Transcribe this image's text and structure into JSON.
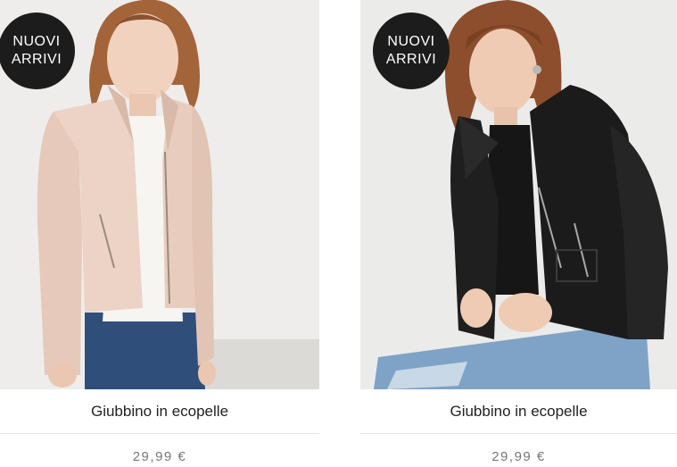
{
  "products": [
    {
      "badge_line1": "NUOVI",
      "badge_line2": "ARRIVI",
      "image": "woman-in-pink-leather-jacket",
      "name": "Giubbino in ecopelle",
      "price": "29,99 €"
    },
    {
      "badge_line1": "NUOVI",
      "badge_line2": "ARRIVI",
      "image": "woman-in-black-leather-jacket",
      "name": "Giubbino in ecopelle",
      "price": "29,99 €"
    }
  ],
  "colors": {
    "badge_bg": "#1c1c1c",
    "pink_jacket": "#ecd3c6",
    "black_jacket": "#1b1b1b",
    "denim": "#2f4f7a"
  }
}
